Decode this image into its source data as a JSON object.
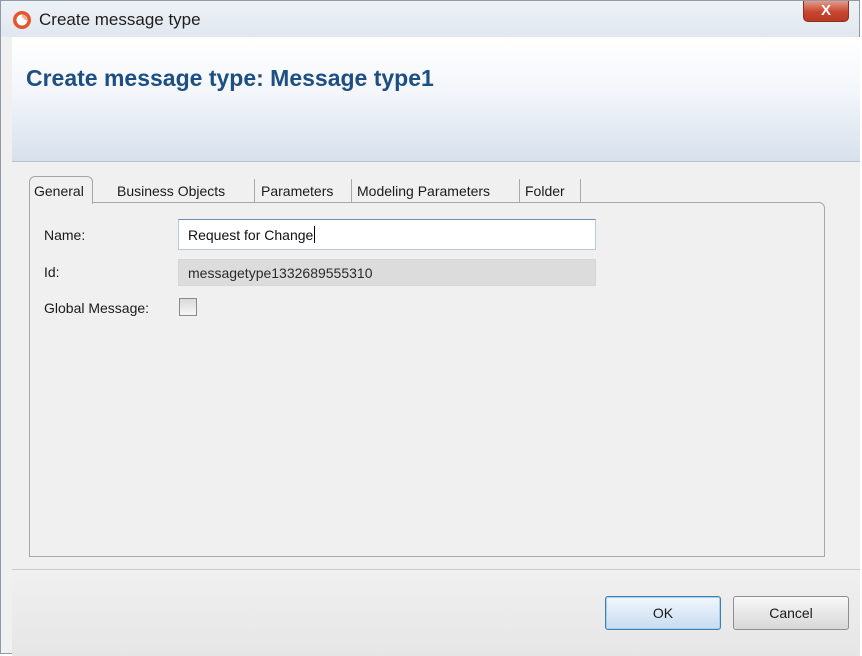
{
  "window": {
    "title": "Create message type",
    "close_glyph": "X"
  },
  "header": {
    "title": "Create message type: Message type1"
  },
  "tabs": [
    {
      "label": "General",
      "active": true
    },
    {
      "label": "Business Objects",
      "active": false
    },
    {
      "label": "Parameters",
      "active": false
    },
    {
      "label": "Modeling Parameters",
      "active": false
    },
    {
      "label": "Folder",
      "active": false
    }
  ],
  "form": {
    "name_label": "Name:",
    "name_value": "Request for Change",
    "id_label": "Id:",
    "id_value": "messagetype1332689555310",
    "global_label": "Global Message:",
    "global_checked": false
  },
  "buttons": {
    "ok_label": "OK",
    "cancel_label": "Cancel"
  },
  "colors": {
    "title_blue": "#1d4f82",
    "close_red": "#c8452e",
    "icon_orange": "#e2572b"
  },
  "icons": {
    "app": "app-logo-icon",
    "close": "close-icon"
  }
}
